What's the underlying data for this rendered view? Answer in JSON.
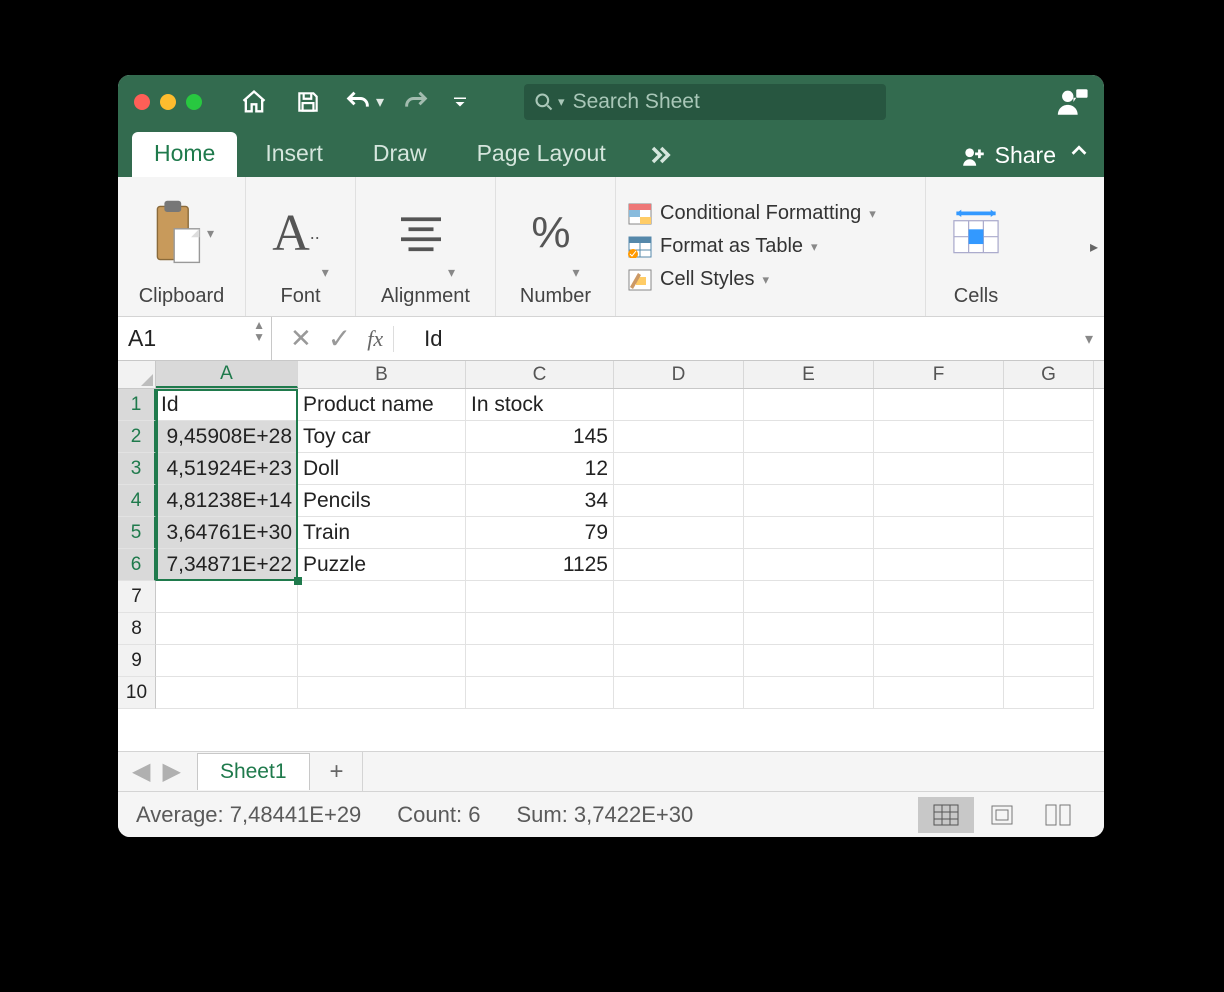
{
  "search": {
    "placeholder": "Search Sheet"
  },
  "tabs": {
    "home": "Home",
    "insert": "Insert",
    "draw": "Draw",
    "pageLayout": "Page Layout"
  },
  "share": "Share",
  "ribbon": {
    "clipboard": "Clipboard",
    "font": "Font",
    "alignment": "Alignment",
    "number": "Number",
    "condFmt": "Conditional Formatting",
    "fmtTable": "Format as Table",
    "cellStyles": "Cell Styles",
    "cells": "Cells"
  },
  "namebox": "A1",
  "fx": "fx",
  "formula": "Id",
  "columns": [
    "A",
    "B",
    "C",
    "D",
    "E",
    "F",
    "G"
  ],
  "rowNums": [
    "1",
    "2",
    "3",
    "4",
    "5",
    "6",
    "7",
    "8",
    "9",
    "10"
  ],
  "grid": {
    "r1": {
      "a": "Id",
      "b": "Product name",
      "c": "In stock"
    },
    "r2": {
      "a": "9,45908E+28",
      "b": "Toy car",
      "c": "145"
    },
    "r3": {
      "a": "4,51924E+23",
      "b": "Doll",
      "c": "12"
    },
    "r4": {
      "a": "4,81238E+14",
      "b": "Pencils",
      "c": "34"
    },
    "r5": {
      "a": "3,64761E+30",
      "b": "Train",
      "c": "79"
    },
    "r6": {
      "a": "7,34871E+22",
      "b": "Puzzle",
      "c": "1125"
    }
  },
  "sheet": "Sheet1",
  "status": {
    "avg": "Average: 7,48441E+29",
    "count": "Count: 6",
    "sum": "Sum: 3,7422E+30"
  }
}
